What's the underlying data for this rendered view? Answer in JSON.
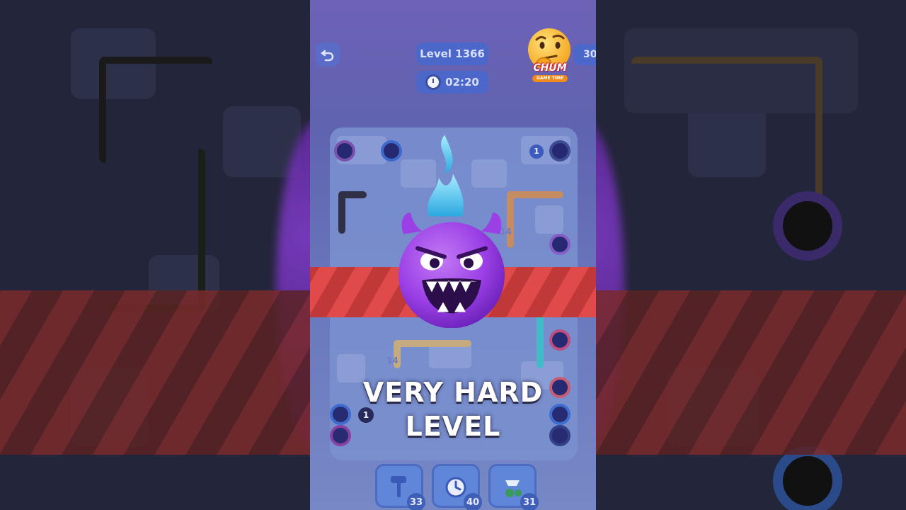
{
  "hud": {
    "level": "Level 1366",
    "timer": "02:20",
    "undo_icon": "undo-icon",
    "right_partial": "30"
  },
  "channel_logo": {
    "emoji": "thinking-face-icon",
    "name": "CHUM",
    "tagline": "GAME TIME"
  },
  "overlay": {
    "emoji": "smiling-devil-icon",
    "caption_line1": "VERY HARD",
    "caption_line2": "LEVEL"
  },
  "board": {
    "labels": [
      "1",
      "1",
      "14",
      "14",
      "1"
    ]
  },
  "powerups": [
    {
      "name": "hammer-icon",
      "count": "33"
    },
    {
      "name": "freeze-timer-icon",
      "count": "40"
    },
    {
      "name": "drag-hand-icon",
      "count": "31"
    }
  ],
  "colors": {
    "panel_bg": "#6a70b8",
    "stripe_red": "#e04a4a",
    "devil_purple": "#9b3fe6",
    "flame_blue": "#4fc8f0",
    "hud_blue": "#4b67c9"
  }
}
